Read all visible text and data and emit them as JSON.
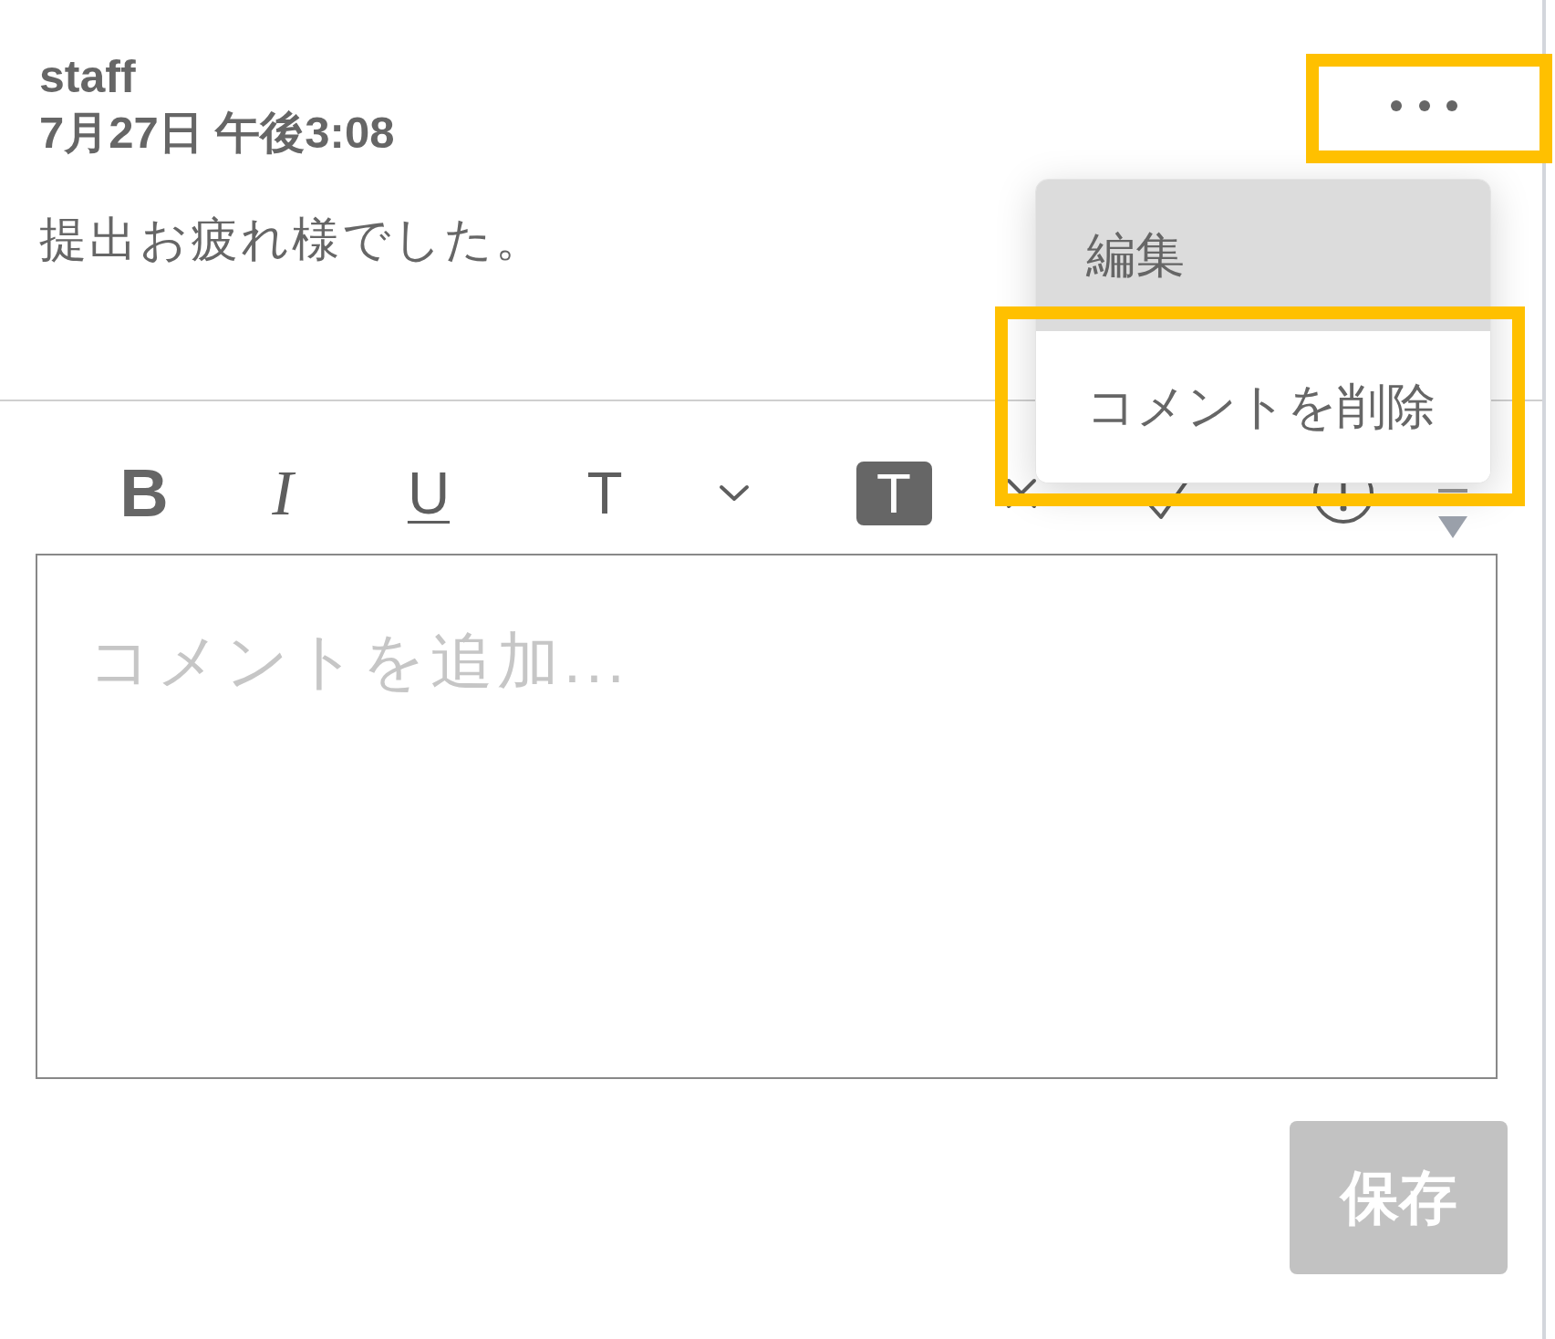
{
  "comment": {
    "author": "staff",
    "timestamp": "7月27日 午後3:08",
    "text": "提出お疲れ様でした。"
  },
  "more_button": {
    "framed": true
  },
  "more_menu": {
    "open": true,
    "items": [
      {
        "label": "編集",
        "highlighted": true,
        "framed": false
      },
      {
        "label": "コメントを削除",
        "highlighted": false,
        "framed": true
      }
    ]
  },
  "editor": {
    "toolbar": [
      {
        "kind": "bold",
        "label": "B"
      },
      {
        "kind": "italic",
        "label": "I"
      },
      {
        "kind": "underline",
        "label": "U"
      },
      {
        "kind": "font",
        "label": "T"
      },
      {
        "kind": "dropdown"
      },
      {
        "kind": "highlight",
        "label": "T"
      },
      {
        "kind": "cross"
      },
      {
        "kind": "check"
      },
      {
        "kind": "alert"
      },
      {
        "kind": "triangle"
      }
    ],
    "placeholder": "コメントを追加..."
  },
  "save_button": {
    "label": "保存",
    "disabled": true
  }
}
